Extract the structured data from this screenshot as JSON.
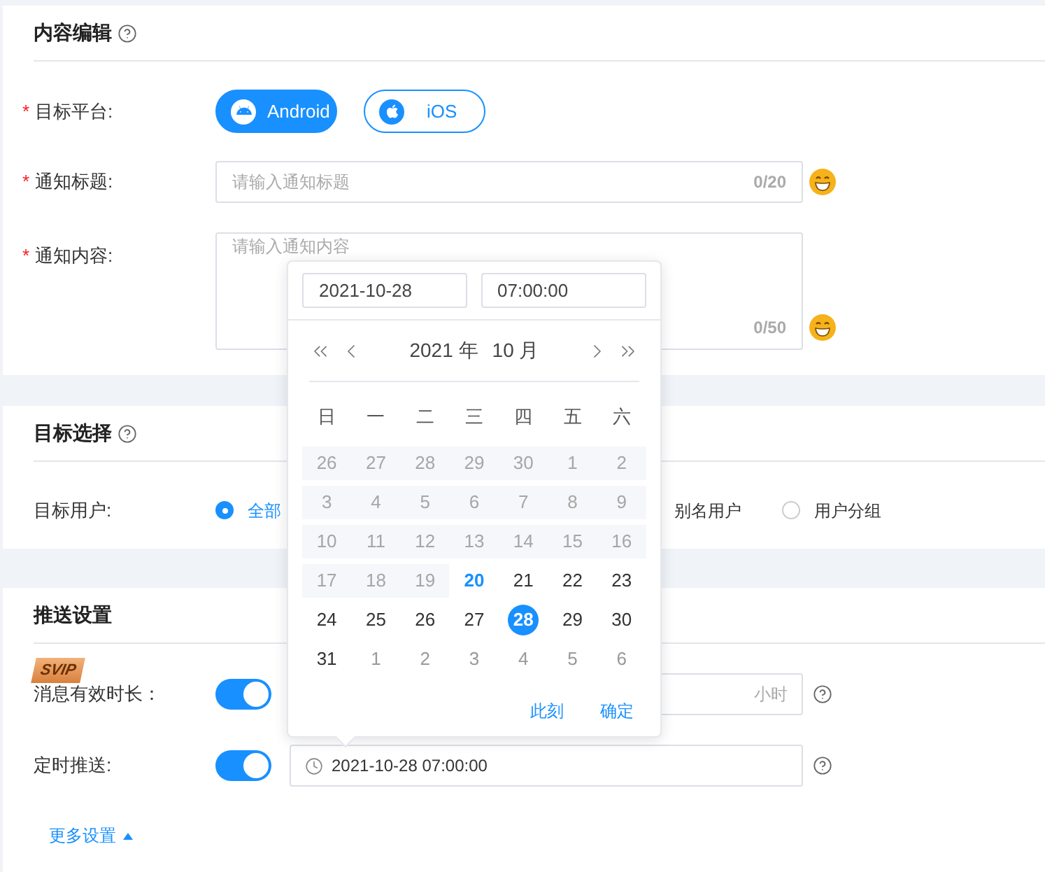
{
  "required_mark": "*",
  "content_section": {
    "title": "内容编辑",
    "platform": {
      "label": "目标平台:",
      "required": true,
      "options": [
        {
          "label": "Android",
          "kind": "android",
          "selected": true
        },
        {
          "label": "iOS",
          "kind": "apple",
          "selected": false
        }
      ]
    },
    "title_field": {
      "label": "通知标题:",
      "required": true,
      "placeholder": "请输入通知标题",
      "counter": "0/20"
    },
    "body_field": {
      "label": "通知内容:",
      "required": true,
      "placeholder": "请输入通知内容",
      "counter": "0/50"
    }
  },
  "target_section": {
    "title": "目标选择",
    "label": "目标用户:",
    "options": [
      {
        "label": "全部",
        "kind": "radio",
        "selected": true
      },
      {
        "label": "别名用户",
        "kind": "label"
      },
      {
        "label": "用户分组",
        "kind": "radio",
        "selected": false
      }
    ]
  },
  "push_section": {
    "title": "推送设置",
    "badge": "SVIP",
    "duration": {
      "label": "消息有效时长：",
      "on": true,
      "suffix": "小时"
    },
    "schedule": {
      "label": "定时推送:",
      "on": true,
      "value": "2021-10-28 07:00:00"
    },
    "more": {
      "label": "更多设置",
      "expanded": true
    }
  },
  "date_picker": {
    "date": "2021-10-28",
    "time": "07:00:00",
    "year": "2021 年",
    "month": "10 月",
    "weekdays": [
      "日",
      "一",
      "二",
      "三",
      "四",
      "五",
      "六"
    ],
    "weeks": [
      [
        {
          "day": "26",
          "kind": "disabled"
        },
        {
          "day": "27",
          "kind": "disabled"
        },
        {
          "day": "28",
          "kind": "disabled"
        },
        {
          "day": "29",
          "kind": "disabled"
        },
        {
          "day": "30",
          "kind": "disabled"
        },
        {
          "day": "1",
          "kind": "disabled"
        },
        {
          "day": "2",
          "kind": "disabled"
        }
      ],
      [
        {
          "day": "3",
          "kind": "disabled"
        },
        {
          "day": "4",
          "kind": "disabled"
        },
        {
          "day": "5",
          "kind": "disabled"
        },
        {
          "day": "6",
          "kind": "disabled"
        },
        {
          "day": "7",
          "kind": "disabled"
        },
        {
          "day": "8",
          "kind": "disabled"
        },
        {
          "day": "9",
          "kind": "disabled"
        }
      ],
      [
        {
          "day": "10",
          "kind": "disabled"
        },
        {
          "day": "11",
          "kind": "disabled"
        },
        {
          "day": "12",
          "kind": "disabled"
        },
        {
          "day": "13",
          "kind": "disabled"
        },
        {
          "day": "14",
          "kind": "disabled"
        },
        {
          "day": "15",
          "kind": "disabled"
        },
        {
          "day": "16",
          "kind": "disabled"
        }
      ],
      [
        {
          "day": "17",
          "kind": "disabled"
        },
        {
          "day": "18",
          "kind": "disabled"
        },
        {
          "day": "19",
          "kind": "disabled"
        },
        {
          "day": "20",
          "kind": "today"
        },
        {
          "day": "21",
          "kind": "normal"
        },
        {
          "day": "22",
          "kind": "normal"
        },
        {
          "day": "23",
          "kind": "normal"
        }
      ],
      [
        {
          "day": "24",
          "kind": "normal"
        },
        {
          "day": "25",
          "kind": "normal"
        },
        {
          "day": "26",
          "kind": "normal"
        },
        {
          "day": "27",
          "kind": "normal"
        },
        {
          "day": "28",
          "kind": "selected"
        },
        {
          "day": "29",
          "kind": "normal"
        },
        {
          "day": "30",
          "kind": "normal"
        }
      ],
      [
        {
          "day": "31",
          "kind": "normal"
        },
        {
          "day": "1",
          "kind": "other"
        },
        {
          "day": "2",
          "kind": "other"
        },
        {
          "day": "3",
          "kind": "other"
        },
        {
          "day": "4",
          "kind": "other"
        },
        {
          "day": "5",
          "kind": "other"
        },
        {
          "day": "6",
          "kind": "other"
        }
      ]
    ],
    "actions": [
      "此刻",
      "确定"
    ]
  }
}
